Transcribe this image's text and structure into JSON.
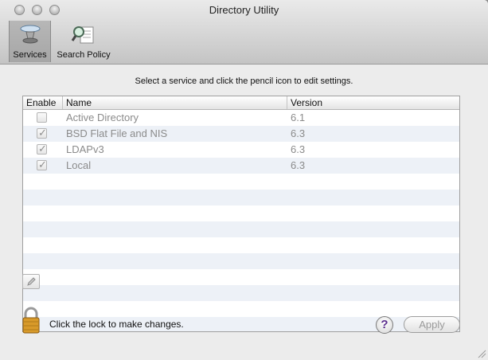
{
  "window": {
    "title": "Directory Utility"
  },
  "toolbar": {
    "items": [
      {
        "label": "Services",
        "selected": true,
        "icon": "services-icon"
      },
      {
        "label": "Search Policy",
        "selected": false,
        "icon": "search-policy-icon"
      }
    ]
  },
  "main": {
    "instruction": "Select a service and click the pencil icon to edit settings.",
    "table": {
      "columns": [
        "Enable",
        "Name",
        "Version"
      ],
      "rows": [
        {
          "enabled": false,
          "name": "Active Directory",
          "version": "6.1"
        },
        {
          "enabled": true,
          "name": "BSD Flat File and NIS",
          "version": "6.3"
        },
        {
          "enabled": true,
          "name": "LDAPv3",
          "version": "6.3"
        },
        {
          "enabled": true,
          "name": "Local",
          "version": "6.3"
        }
      ]
    }
  },
  "footer": {
    "lock_text": "Click the lock to make changes.",
    "help_label": "?",
    "apply_label": "Apply"
  },
  "colors": {
    "disabled_text": "#8b8b8b",
    "help_accent": "#5b2d8e",
    "lock_gold": "#d89a2a"
  }
}
